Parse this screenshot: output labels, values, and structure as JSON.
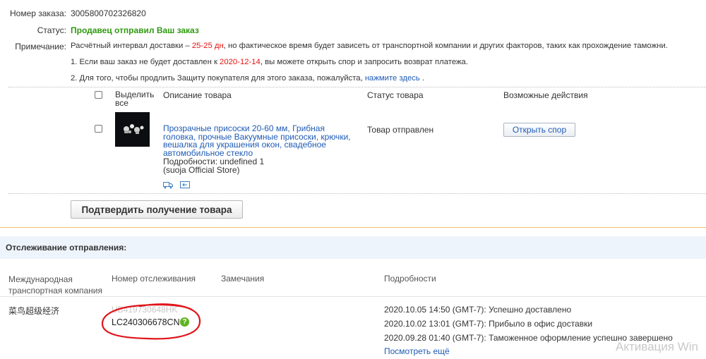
{
  "order": {
    "number_label": "Номер заказа:",
    "number_value": "3005800702326820",
    "status_label": "Статус:",
    "status_value": "Продавец отправил Ваш заказ",
    "note_label": "Примечание:",
    "note_part1": "Расчётный интервал доставки –",
    "note_days": "25-25 дн",
    "note_part2": ", но фактическое время будет зависеть от транспортной компании и других факторов, таких как прохождение таможни.",
    "note1_part1": "1. Если ваш заказ не будет доставлен к",
    "note1_date": "2020-12-14",
    "note1_part2": ", вы можете открыть спор и запросить возврат платежа.",
    "note2_part1": "2. Для того, чтобы продлить Защиту покупателя для этого заказа, пожалуйста,",
    "note2_link": "нажмите здесь",
    "note2_end": "."
  },
  "items_table": {
    "headers": {
      "select_all": "Выделить все",
      "description": "Описание товара",
      "status": "Статус товара",
      "actions": "Возможные действия"
    },
    "item": {
      "title": "Прозрачные присоски 20-60 мм, Грибная головка, прочные Вакуумные присоски, крючки, вешалка для украшения окон, свадебное автомобильное стекло",
      "details": "Подробности: undefined 1",
      "store": "(suoja Official Store)",
      "status": "Товар отправлен",
      "action_button": "Открыть спор",
      "icons": [
        "truck-icon",
        "return-icon"
      ]
    },
    "confirm_button": "Подтвердить получение товара"
  },
  "tracking": {
    "section_title": "Отслеживание отправления:",
    "headers": {
      "carrier": "Международная транспортная компания",
      "tracking_number": "Номер отслеживания",
      "remarks": "Замечания",
      "details": "Подробности"
    },
    "carrier_name": "菜鸟超级经济",
    "old_tracking": "UB419730648HK",
    "tracking_number": "LC240306678CN",
    "events": [
      "2020.10.05 14:50 (GMT-7): Успешно доставлено",
      "2020.10.02 13:01 (GMT-7): Прибыло в офис доставки",
      "2020.09.28 01:40 (GMT-7): Таможенное оформление успешно завершено"
    ],
    "more_link": "Посмотреть ещё"
  },
  "watermark": "Активация Win",
  "colors": {
    "status_green": "#2f9a0f",
    "highlight_red": "#e4120c",
    "link_blue": "#1f5bb5",
    "annotation_red": "#e0141a",
    "qmark_green": "#5fb31f"
  }
}
